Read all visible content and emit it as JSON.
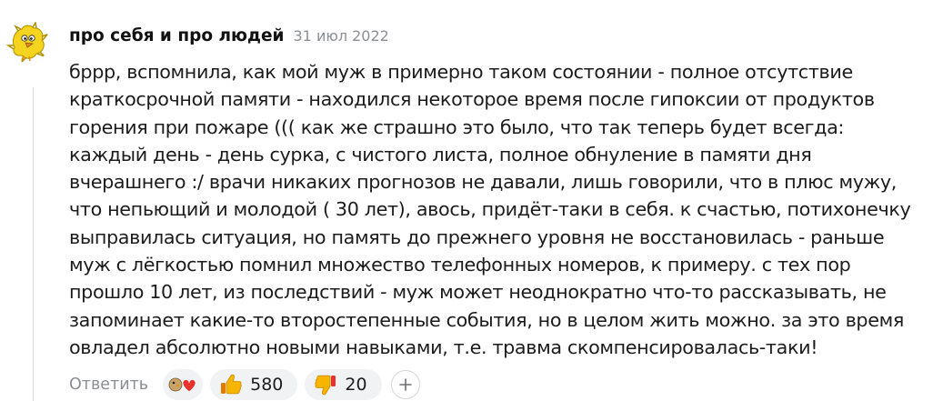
{
  "comment": {
    "author": "про себя и про людей",
    "date": "31 июл 2022",
    "lines": [
      "бррр, вспомнила, как мой муж в примерно таком состоянии - полное отсутствие",
      "краткосрочной памяти - находился некоторое время после гипоксии от продуктов",
      "горения при пожаре ((( как же страшно это было, что так теперь будет всегда:",
      "каждый день - день сурка, с чистого листа, полное обнуление в памяти дня",
      "вчерашнего :/ врачи никаких прогнозов не давали, лишь говорили, что в плюс мужу,",
      "что непьющий и молодой ( 30 лет), авось, придёт-таки в себя. к счастью, потихонечку",
      "выправилась ситуация, но память до прежнего уровня не восстановилась - раньше",
      "муж с лёгкостью помнил множество телефонных номеров, к примеру. с тех пор",
      "прошло 10 лет, из последствий - муж может неоднократно что-то рассказывать, не",
      "запоминает какие-то второстепенные события, но в целом жить можно. за это время",
      "овладел абсолютно новыми навыками, т.е. травма скомпенсировалась-таки!"
    ]
  },
  "actions": {
    "reply_label": "Ответить",
    "like_count": "580",
    "dislike_count": "20"
  },
  "icons": {
    "avatar": "yellow-bird-avatar",
    "reactions": "reactions-stack-icon",
    "like": "thumbs-up-icon",
    "dislike": "thumbs-down-icon",
    "add_reaction": "plus-icon"
  },
  "colors": {
    "reaction_yellow": "#f7b500",
    "pill_background": "#f1f2f4",
    "meta_gray": "#8b8e93"
  }
}
